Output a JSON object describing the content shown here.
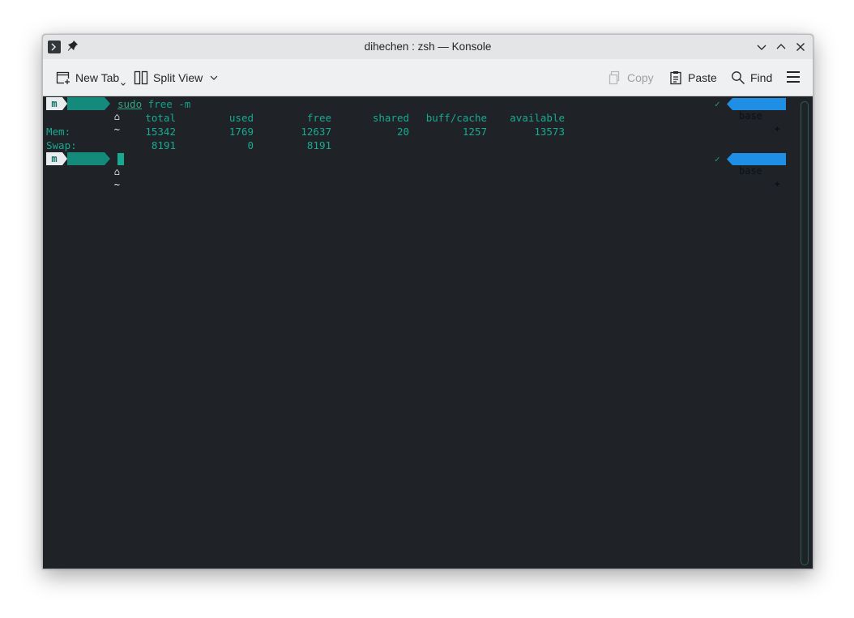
{
  "window": {
    "title": "dihechen : zsh — Konsole"
  },
  "toolbar": {
    "new_tab_label": "New Tab",
    "split_view_label": "Split View",
    "copy_label": "Copy",
    "paste_label": "Paste",
    "find_label": "Find"
  },
  "terminal": {
    "prompt": {
      "dir_symbol": "~",
      "env_name": "base",
      "status_symbol": "✓"
    },
    "command": {
      "program": "sudo",
      "text": "free -m"
    },
    "free_output": {
      "headers": [
        "total",
        "used",
        "free",
        "shared",
        "buff/cache",
        "available"
      ],
      "rows": [
        {
          "label": "Mem:",
          "values": [
            "15342",
            "1769",
            "12637",
            "20",
            "1257",
            "13573"
          ]
        },
        {
          "label": "Swap:",
          "values": [
            "8191",
            "0",
            "8191",
            "",
            "",
            ""
          ]
        }
      ]
    }
  },
  "colors": {
    "terminal_bg": "#1f2328",
    "terminal_fg": "#18a991",
    "env_badge": "#1e8fe4",
    "titlebar_bg": "#e4e5e7",
    "toolbar_bg": "#eff0f1"
  }
}
